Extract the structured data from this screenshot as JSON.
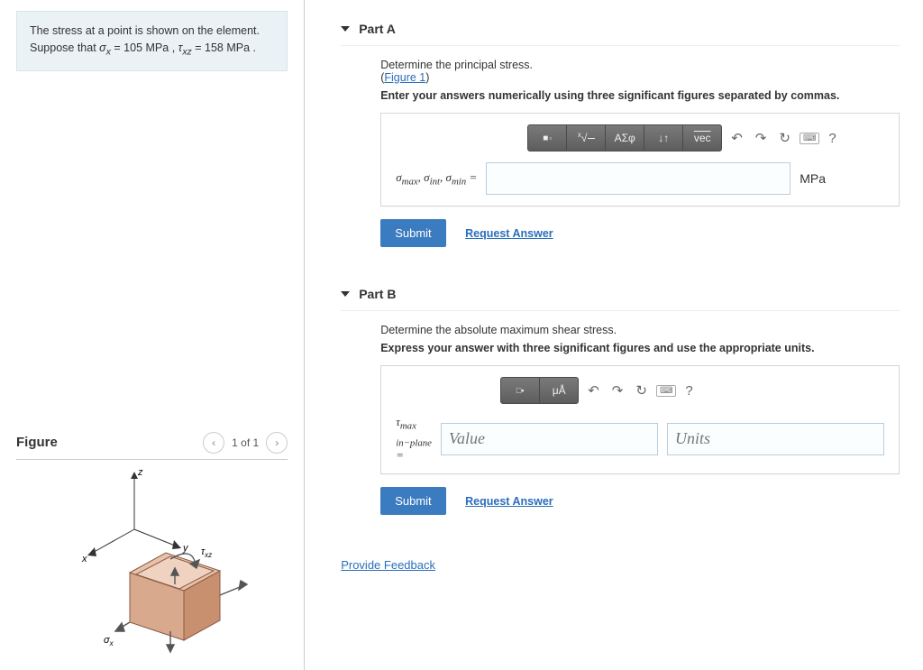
{
  "problem": {
    "text_prefix": "The stress at a point is shown on the element. Suppose that ",
    "sigma_var": "σ",
    "sigma_sub": "x",
    "equals1": " = ",
    "sigma_val": "105 MPa",
    "sep": " , ",
    "tau_var": "τ",
    "tau_sub": "xz",
    "equals2": " = 158 MPa ."
  },
  "figure": {
    "title": "Figure",
    "page": "1 of 1",
    "axis_x": "x",
    "axis_y": "y",
    "axis_z": "z",
    "tau_label": "τ",
    "tau_sub": "xz",
    "sigma_label": "σ",
    "sigma_sub": "x"
  },
  "partA": {
    "title": "Part A",
    "prompt": "Determine the principal stress.",
    "figure_link": "Figure 1",
    "instruction": "Enter your answers numerically using three significant figures separated by commas.",
    "toolbar": {
      "templates": "⬛",
      "root": "√",
      "greek": "ΑΣφ",
      "subsup": "↓↑",
      "vec": "vec",
      "undo": "↶",
      "redo": "↷",
      "reset": "↻",
      "keyboard": "⌨",
      "help": "?"
    },
    "answer_label_sigma": "σ",
    "answer_label_max": "max",
    "answer_label_int": "int",
    "answer_label_min": "min",
    "equals": " = ",
    "unit": "MPa",
    "submit": "Submit",
    "request": "Request Answer"
  },
  "partB": {
    "title": "Part B",
    "prompt": "Determine the absolute maximum shear stress.",
    "instruction": "Express your answer with three significant figures and use the appropriate units.",
    "toolbar": {
      "templates": "⬛",
      "units": "μÅ",
      "undo": "↶",
      "redo": "↷",
      "reset": "↻",
      "keyboard": "⌨",
      "help": "?"
    },
    "answer_label_tau": "τ",
    "answer_label_sub1": "max in−plane",
    "equals": " = ",
    "value_placeholder": "Value",
    "units_placeholder": "Units",
    "submit": "Submit",
    "request": "Request Answer"
  },
  "feedback": "Provide Feedback"
}
